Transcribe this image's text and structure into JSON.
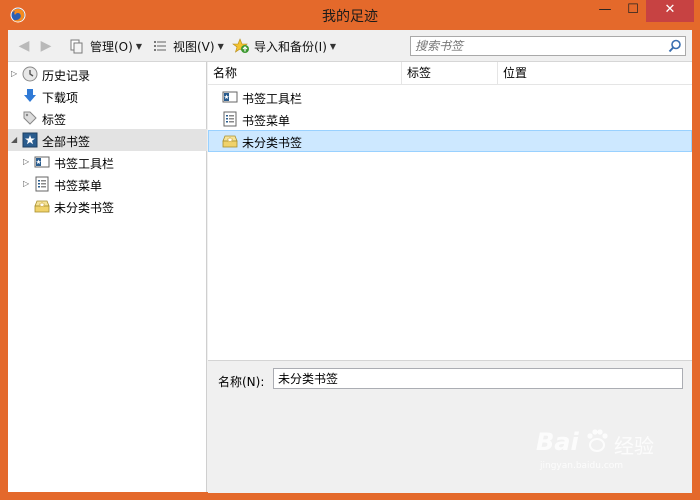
{
  "window": {
    "title": "我的足迹",
    "min_glyph": "—",
    "max_glyph": "☐",
    "close_glyph": "✕",
    "accent": "#e4692b"
  },
  "toolbar": {
    "back_glyph": "◀",
    "forward_glyph": "▶",
    "manage_label": "管理(O)",
    "view_label": "视图(V)",
    "import_label": "导入和备份(I)",
    "search_placeholder": "搜索书签"
  },
  "sidebar": {
    "items": [
      {
        "label": "历史记录",
        "icon": "clock-icon",
        "expandable": true
      },
      {
        "label": "下载项",
        "icon": "download-arrow-icon",
        "expandable": false
      },
      {
        "label": "标签",
        "icon": "tag-icon",
        "expandable": false
      },
      {
        "label": "全部书签",
        "icon": "star-folder-icon",
        "expandable": true,
        "selected": true
      },
      {
        "label": "书签工具栏",
        "icon": "toolbar-folder-icon",
        "expandable": true
      },
      {
        "label": "书签菜单",
        "icon": "menu-folder-icon",
        "expandable": true
      },
      {
        "label": "未分类书签",
        "icon": "unsorted-folder-icon",
        "expandable": false
      }
    ]
  },
  "columns": [
    "名称",
    "标签",
    "位置"
  ],
  "list": [
    {
      "label": "书签工具栏",
      "icon": "toolbar-folder-icon"
    },
    {
      "label": "书签菜单",
      "icon": "menu-folder-icon"
    },
    {
      "label": "未分类书签",
      "icon": "unsorted-folder-icon",
      "selected": true
    }
  ],
  "detail": {
    "name_label": "名称(N):",
    "name_value": "未分类书签"
  },
  "watermark": {
    "brand": "Bai",
    "brand2": "经验",
    "url": "jingyan.baidu.com"
  }
}
